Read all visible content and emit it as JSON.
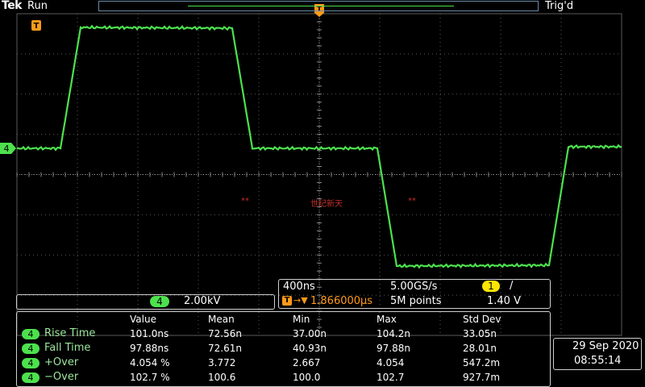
{
  "header": {
    "brand": "Tek",
    "run_state": "Run",
    "trigger_state": "Trig'd"
  },
  "channel": {
    "number": "4",
    "scale": "2.00kV"
  },
  "horizontal": {
    "time_per_div": "400ns",
    "sample_rate": "5.00GS/s",
    "trigger_position": "1.866000µs",
    "record_length": "5M points"
  },
  "trigger": {
    "source": "1",
    "slope": "/",
    "level": "1.40 V",
    "marker_label": "T"
  },
  "measurements": {
    "headers": [
      "Value",
      "Mean",
      "Min",
      "Max",
      "Std Dev"
    ],
    "rows": [
      {
        "channel": "4",
        "name": "Rise Time",
        "value": "101.0ns",
        "mean": "72.56n",
        "min": "37.00n",
        "max": "104.2n",
        "std": "33.05n"
      },
      {
        "channel": "4",
        "name": "Fall Time",
        "value": "97.88ns",
        "mean": "72.61n",
        "min": "40.93n",
        "max": "97.88n",
        "std": "28.01n"
      },
      {
        "channel": "4",
        "name": "+Over",
        "value": "4.054 %",
        "mean": "3.772",
        "min": "2.667",
        "max": "4.054",
        "std": "547.2m"
      },
      {
        "channel": "4",
        "name": "−Over",
        "value": "102.7 %",
        "mean": "100.6",
        "min": "100.0",
        "max": "102.7",
        "std": "927.7m"
      }
    ]
  },
  "datetime": {
    "date": "29 Sep  2020",
    "time": "08:55:14"
  },
  "watermark": {
    "left": "**",
    "center": "世纪新天",
    "right": "**"
  },
  "colors": {
    "trace": "#4de14d",
    "grid": "#5a5a5a",
    "trigger_marker": "#ff9a1a",
    "trigger_badge": "#ffe600",
    "panel_border": "#cfcfcf"
  }
}
